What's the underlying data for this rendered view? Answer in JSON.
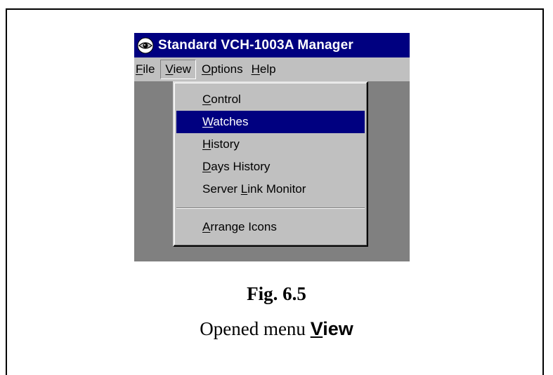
{
  "window": {
    "title": "Standard VCH-1003A Manager",
    "app_icon": "eye-icon"
  },
  "menubar": {
    "items": [
      {
        "label": "File",
        "mnemonic": "F",
        "rest": "ile"
      },
      {
        "label": "View",
        "mnemonic": "V",
        "rest": "iew"
      },
      {
        "label": "Options",
        "mnemonic": "O",
        "rest": "ptions"
      },
      {
        "label": "Help",
        "mnemonic": "H",
        "rest": "elp"
      }
    ],
    "active": "View"
  },
  "dropdown": {
    "items": [
      {
        "label": "Control",
        "pre": "",
        "mnemonic": "C",
        "rest": "ontrol"
      },
      {
        "label": "Watches",
        "pre": "",
        "mnemonic": "W",
        "rest": "atches"
      },
      {
        "label": "History",
        "pre": "",
        "mnemonic": "H",
        "rest": "istory"
      },
      {
        "label": "Days History",
        "pre": "",
        "mnemonic": "D",
        "rest": "ays History"
      },
      {
        "label": "Server Link Monitor",
        "pre": "Server ",
        "mnemonic": "L",
        "rest": "ink Monitor"
      },
      {
        "label": "Arrange Icons",
        "pre": "",
        "mnemonic": "A",
        "rest": "rrange Icons"
      }
    ],
    "highlighted": "Watches"
  },
  "caption": {
    "figure": "Fig. 6.5",
    "text_prefix": "Opened menu ",
    "menu_word_mnemonic": "V",
    "menu_word_rest": "iew"
  },
  "colors": {
    "titlebar": "#000080",
    "highlight": "#000080",
    "menu_face": "#c0c0c0",
    "workspace": "#808080"
  }
}
